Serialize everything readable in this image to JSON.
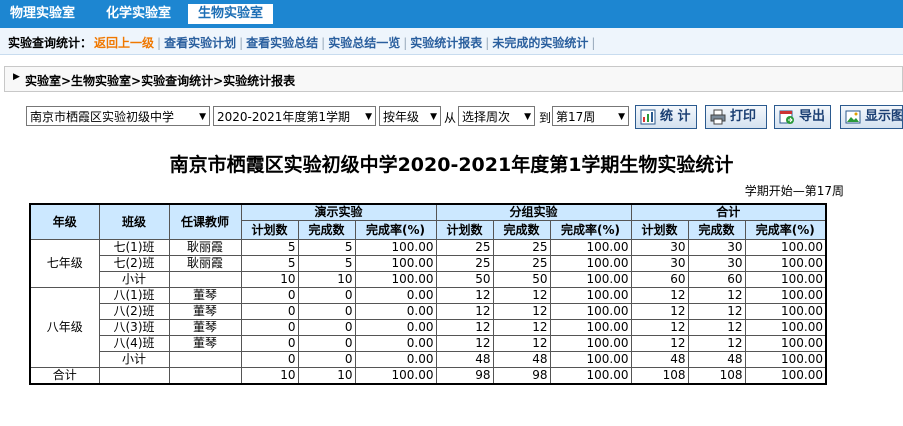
{
  "top_tabs": [
    {
      "label": "物理实验室",
      "active": false
    },
    {
      "label": "化学实验室",
      "active": false
    },
    {
      "label": "生物实验室",
      "active": true
    }
  ],
  "subnav": {
    "label": "实验查询统计：",
    "back": "返回上一级",
    "links": [
      "查看实验计划",
      "查看实验总结",
      "实验总结一览",
      "实验统计报表",
      "未完成的实验统计"
    ]
  },
  "breadcrumb": "实验室>生物实验室>实验查询统计>实验统计报表",
  "filters": {
    "school": "南京市栖霞区实验初级中学",
    "term": "2020-2021年度第1学期",
    "group_by": "按年级",
    "from_label": "从",
    "from_week": "选择周次",
    "to_label": "到",
    "to_week": "第17周"
  },
  "buttons": {
    "stat": "统 计",
    "print": "打印",
    "export": "导出",
    "display": "显示图"
  },
  "report": {
    "title": "南京市栖霞区实验初级中学2020-2021年度第1学期生物实验统计",
    "period": "学期开始—第17周",
    "headers": {
      "grade": "年级",
      "class": "班级",
      "teacher": "任课教师",
      "demo": "演示实验",
      "group": "分组实验",
      "total": "合计",
      "planned": "计划数",
      "done": "完成数",
      "rate": "完成率(%)"
    },
    "rows": [
      {
        "grade": "七年级",
        "class": "七(1)班",
        "teacher": "耿丽霞",
        "d": [
          "5",
          "5",
          "100.00"
        ],
        "g": [
          "25",
          "25",
          "100.00"
        ],
        "t": [
          "30",
          "30",
          "100.00"
        ]
      },
      {
        "grade": "",
        "class": "七(2)班",
        "teacher": "耿丽霞",
        "d": [
          "5",
          "5",
          "100.00"
        ],
        "g": [
          "25",
          "25",
          "100.00"
        ],
        "t": [
          "30",
          "30",
          "100.00"
        ]
      },
      {
        "grade": "",
        "class": "小计",
        "teacher": "",
        "d": [
          "10",
          "10",
          "100.00"
        ],
        "g": [
          "50",
          "50",
          "100.00"
        ],
        "t": [
          "60",
          "60",
          "100.00"
        ]
      },
      {
        "grade": "八年级",
        "class": "八(1)班",
        "teacher": "董琴",
        "d": [
          "0",
          "0",
          "0.00"
        ],
        "g": [
          "12",
          "12",
          "100.00"
        ],
        "t": [
          "12",
          "12",
          "100.00"
        ]
      },
      {
        "grade": "",
        "class": "八(2)班",
        "teacher": "董琴",
        "d": [
          "0",
          "0",
          "0.00"
        ],
        "g": [
          "12",
          "12",
          "100.00"
        ],
        "t": [
          "12",
          "12",
          "100.00"
        ]
      },
      {
        "grade": "",
        "class": "八(3)班",
        "teacher": "董琴",
        "d": [
          "0",
          "0",
          "0.00"
        ],
        "g": [
          "12",
          "12",
          "100.00"
        ],
        "t": [
          "12",
          "12",
          "100.00"
        ]
      },
      {
        "grade": "",
        "class": "八(4)班",
        "teacher": "董琴",
        "d": [
          "0",
          "0",
          "0.00"
        ],
        "g": [
          "12",
          "12",
          "100.00"
        ],
        "t": [
          "12",
          "12",
          "100.00"
        ]
      },
      {
        "grade": "",
        "class": "小计",
        "teacher": "",
        "d": [
          "0",
          "0",
          "0.00"
        ],
        "g": [
          "48",
          "48",
          "100.00"
        ],
        "t": [
          "48",
          "48",
          "100.00"
        ]
      },
      {
        "grade": "合计",
        "class": "",
        "teacher": "",
        "d": [
          "10",
          "10",
          "100.00"
        ],
        "g": [
          "98",
          "98",
          "100.00"
        ],
        "t": [
          "108",
          "108",
          "100.00"
        ]
      }
    ]
  }
}
